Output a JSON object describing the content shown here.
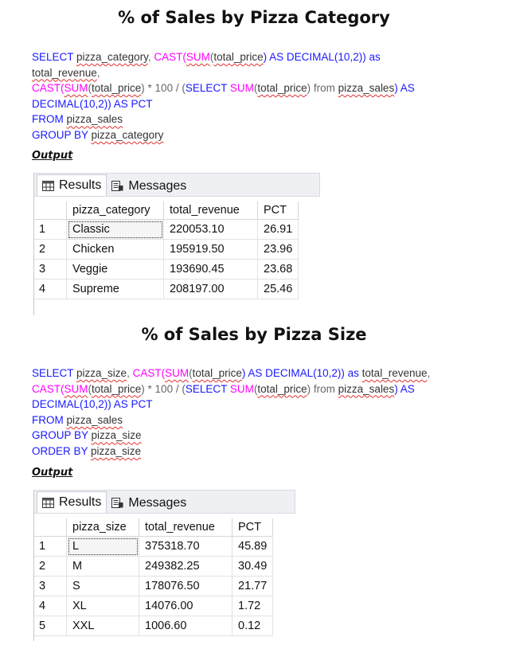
{
  "section1": {
    "title": "% of Sales by Pizza Category",
    "sql": {
      "l1": [
        "SELECT ",
        "pizza_category",
        ", ",
        "CAST(",
        "SUM",
        "(",
        "total_price",
        ") AS DECIMAL(10,2)) as"
      ],
      "l2": [
        "total_revenue",
        ","
      ],
      "l3": [
        "CAST(",
        "SUM",
        "(",
        "total_price",
        ") * 100 / (",
        "SELECT ",
        "SUM",
        "(",
        "total_price",
        ") from ",
        "pizza_sales",
        ") AS"
      ],
      "l4": "DECIMAL(10,2)) AS PCT",
      "l5": [
        "FROM ",
        "pizza_sales"
      ],
      "l6": [
        "GROUP BY ",
        "pizza_category"
      ]
    },
    "output_label": "Output",
    "tabs": [
      "Results",
      "Messages"
    ],
    "columns": [
      "pizza_category",
      "total_revenue",
      "PCT"
    ],
    "rows": [
      [
        "1",
        "Classic",
        "220053.10",
        "26.91"
      ],
      [
        "2",
        "Chicken",
        "195919.50",
        "23.96"
      ],
      [
        "3",
        "Veggie",
        "193690.45",
        "23.68"
      ],
      [
        "4",
        "Supreme",
        "208197.00",
        "25.46"
      ]
    ]
  },
  "section2": {
    "title": "% of Sales by Pizza Size",
    "sql": {
      "l1": [
        "SELECT ",
        "pizza_size",
        ", ",
        "CAST(",
        "SUM",
        "(",
        "total_price",
        ") AS DECIMAL(10,2)) as ",
        "total_revenue",
        ","
      ],
      "l2": [
        "CAST(",
        "SUM",
        "(",
        "total_price",
        ") * 100 / (",
        "SELECT ",
        "SUM",
        "(",
        "total_price",
        ") from ",
        "pizza_sales",
        ") AS"
      ],
      "l3": "DECIMAL(10,2)) AS PCT",
      "l4": [
        "FROM ",
        "pizza_sales"
      ],
      "l5": [
        "GROUP BY ",
        "pizza_size"
      ],
      "l6": [
        "ORDER BY ",
        "pizza_size"
      ]
    },
    "output_label": "Output",
    "tabs": [
      "Results",
      "Messages"
    ],
    "columns": [
      "pizza_size",
      "total_revenue",
      "PCT"
    ],
    "rows": [
      [
        "1",
        "L",
        "375318.70",
        "45.89"
      ],
      [
        "2",
        "M",
        "249382.25",
        "30.49"
      ],
      [
        "3",
        "S",
        "178076.50",
        "21.77"
      ],
      [
        "4",
        "XL",
        "14076.00",
        "1.72"
      ],
      [
        "5",
        "XXL",
        "1006.60",
        "0.12"
      ]
    ]
  }
}
